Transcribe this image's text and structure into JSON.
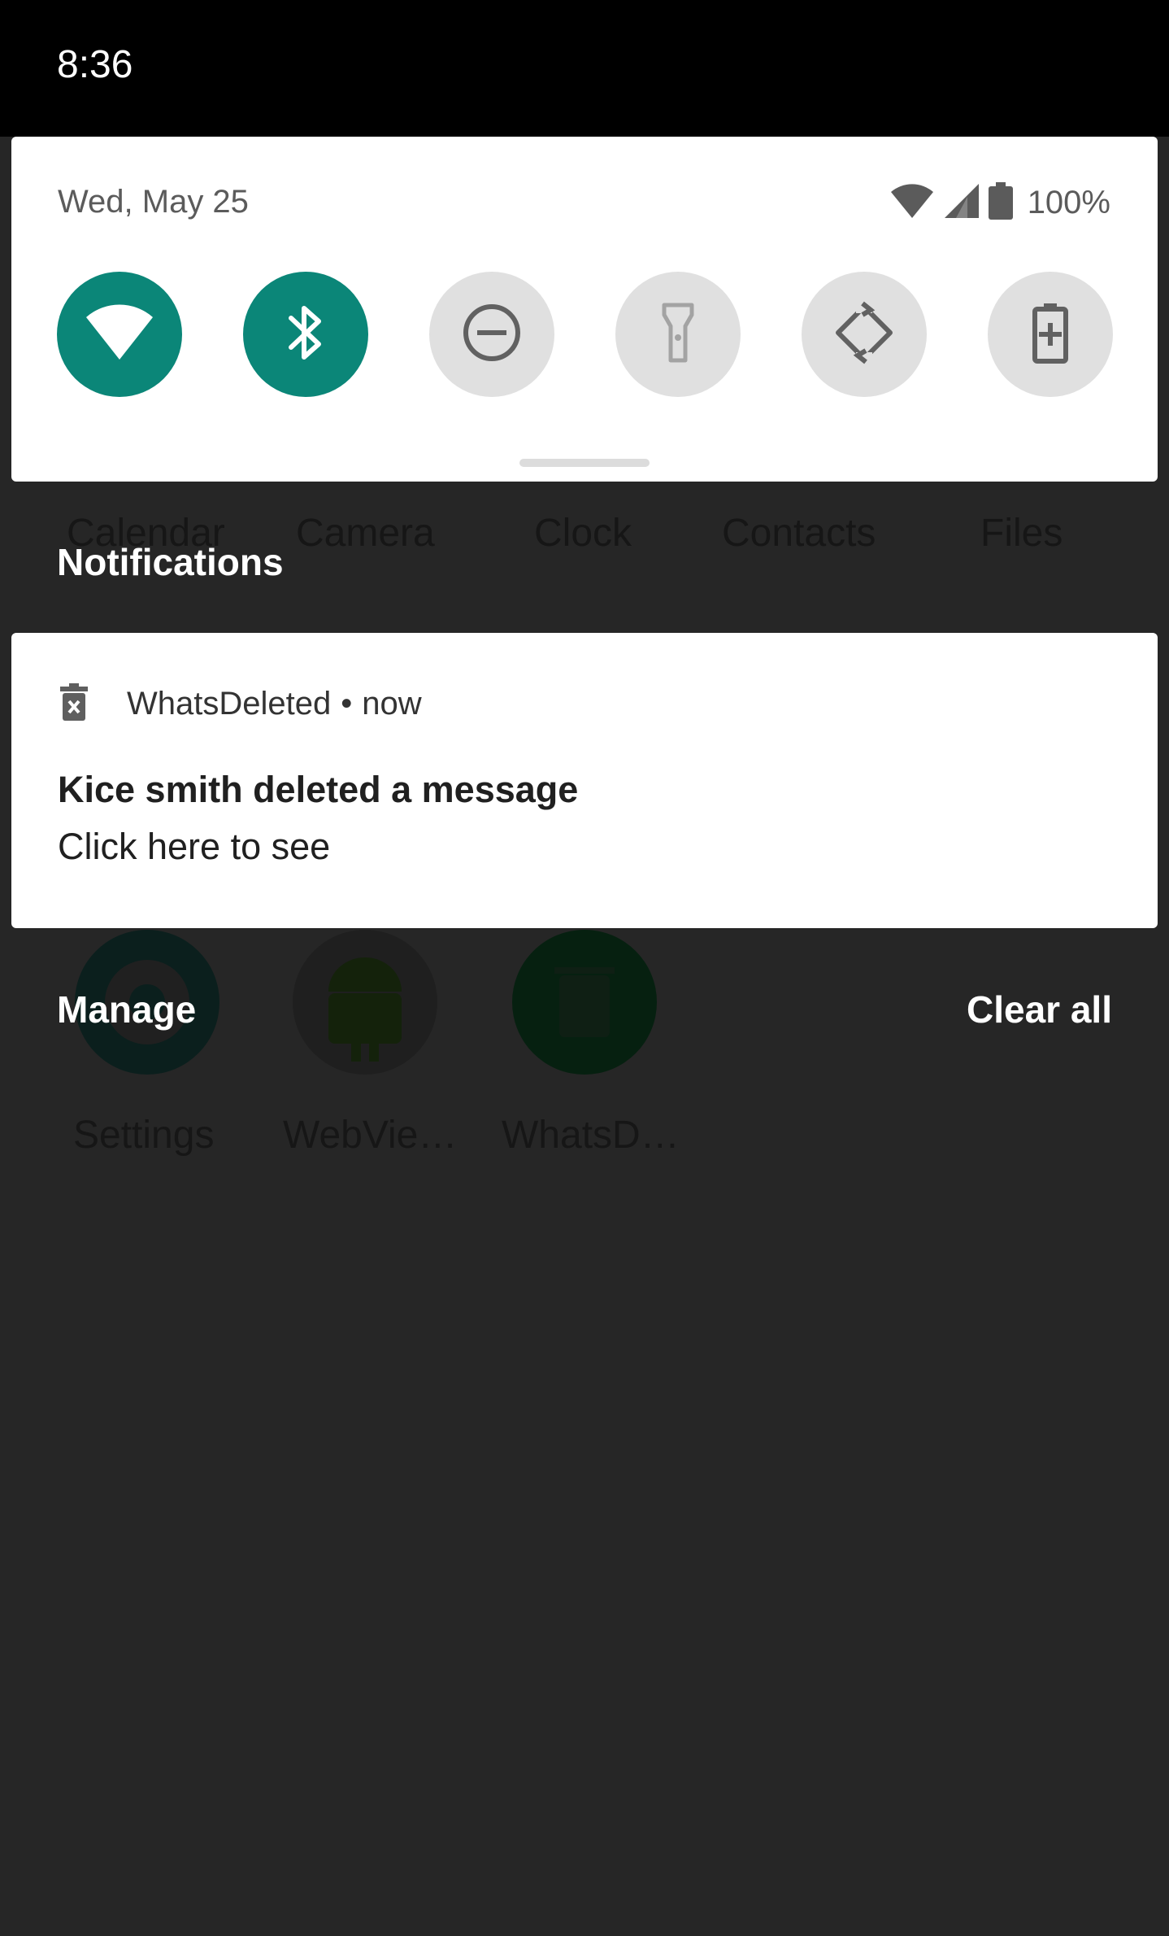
{
  "status_bar": {
    "time": "8:36"
  },
  "quick_settings": {
    "date": "Wed, May 25",
    "battery_percent": "100%",
    "tiles": [
      {
        "name": "wifi",
        "icon": "wifi-icon",
        "active": true
      },
      {
        "name": "bluetooth",
        "icon": "bluetooth-icon",
        "active": true
      },
      {
        "name": "do-not-disturb",
        "icon": "do-not-disturb-icon",
        "active": false
      },
      {
        "name": "flashlight",
        "icon": "flashlight-icon",
        "active": false
      },
      {
        "name": "auto-rotate",
        "icon": "auto-rotate-icon",
        "active": false
      },
      {
        "name": "battery-saver",
        "icon": "battery-saver-icon",
        "active": false
      }
    ]
  },
  "background_apps": {
    "row1_labels": [
      "Calendar",
      "Camera",
      "Clock",
      "Contacts",
      "Files"
    ],
    "row2_labels": [
      "Settings",
      "WebVie…",
      "WhatsD…"
    ]
  },
  "notifications": {
    "header": "Notifications",
    "items": [
      {
        "app_icon": "trash-x-icon",
        "app_name": "WhatsDeleted",
        "separator": "•",
        "time": "now",
        "title": "Kice smith deleted a message",
        "text": "Click here to see"
      }
    ],
    "manage_label": "Manage",
    "clear_all_label": "Clear all"
  },
  "colors": {
    "tile_active": "#0b8678",
    "tile_inactive": "#e0e0e0",
    "scrim": "#262626"
  }
}
